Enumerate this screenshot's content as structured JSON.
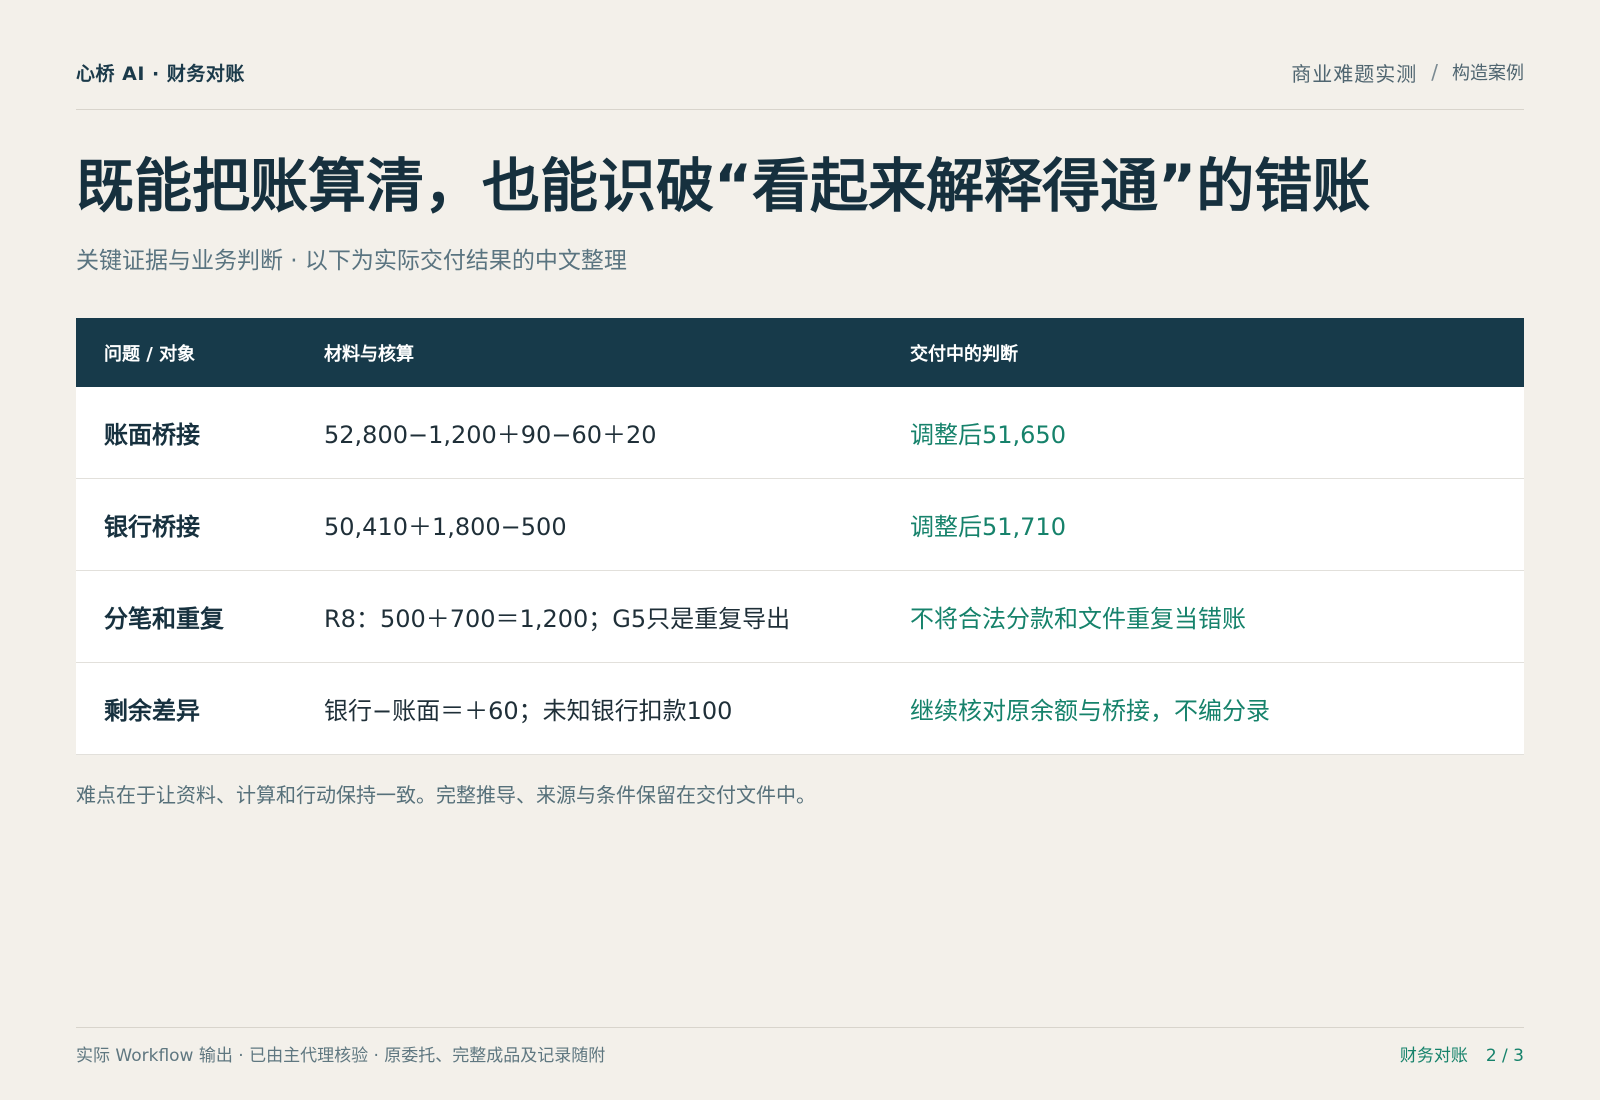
{
  "header": {
    "brand": "心桥 AI · 财务对账",
    "breadcrumb_main": "商业难题实测",
    "breadcrumb_sep": "/",
    "breadcrumb_sub": "构造案例"
  },
  "title": "既能把账算清，也能识破“看起来解释得通”的错账",
  "subtitle": "关键证据与业务判断 · 以下为实际交付结果的中文整理",
  "table": {
    "headers": [
      "问题 / 对象",
      "材料与核算",
      "交付中的判断"
    ],
    "rows": [
      [
        "账面桥接",
        "52,800−1,200＋90−60＋20",
        "调整后51,650"
      ],
      [
        "银行桥接",
        "50,410＋1,800−500",
        "调整后51,710"
      ],
      [
        "分笔和重复",
        "R8：500＋700＝1,200；G5只是重复导出",
        "不将合法分款和文件重复当错账"
      ],
      [
        "剩余差异",
        "银行−账面＝＋60；未知银行扣款100",
        "继续核对原余额与桥接，不编分录"
      ]
    ]
  },
  "note": "难点在于让资料、计算和行动保持一致。完整推导、来源与条件保留在交付文件中。",
  "footer": {
    "left": "实际 Workflow 输出 · 已由主代理核验 · 原委托、完整成品及记录随附",
    "section": "财务对账",
    "page": "2 / 3"
  }
}
